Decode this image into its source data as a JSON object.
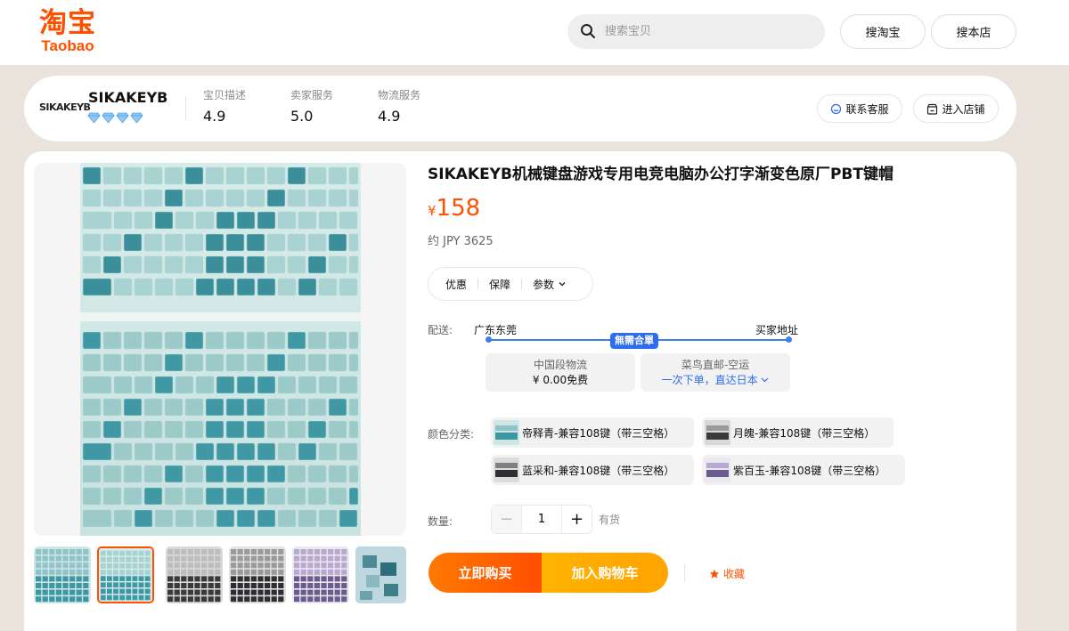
{
  "header": {
    "logo_cn": "淘宝",
    "logo_en": "Taobao",
    "search_placeholder": "搜索宝贝",
    "search_taobao_label": "搜淘宝",
    "search_shop_label": "搜本店"
  },
  "shop": {
    "logo_text": "SIKAKEYB",
    "name": "SIKAKEYB",
    "diamond_count": 4,
    "metrics": [
      {
        "label": "宝贝描述",
        "value": "4.9"
      },
      {
        "label": "卖家服务",
        "value": "5.0"
      },
      {
        "label": "物流服务",
        "value": "4.9"
      }
    ],
    "contact_label": "联系客服",
    "enter_shop_label": "进入店铺"
  },
  "product": {
    "title": "SIKAKEYB机械键盘游戏专用电竞电脑办公打字渐变色原厂PBT键帽",
    "currency_symbol": "¥",
    "price": "158",
    "approx_price": "约 JPY 3625",
    "tabs": [
      "优惠",
      "保障",
      "参数"
    ],
    "shipping": {
      "label": "配送:",
      "from": "广东东莞",
      "to": "买家地址",
      "badge": "無需合單",
      "options": [
        {
          "line1": "中国段物流",
          "line2": "¥ 0.00免费"
        },
        {
          "line1": "菜鸟直邮-空运",
          "line2": "一次下单，直达日本"
        }
      ]
    },
    "color_label": "颜色分类:",
    "variants": [
      "帝释青-兼容108键（带三空格）",
      "月魄-兼容108键（带三空格）",
      "蓝采和-兼容108键（带三空格）",
      "紫百玉-兼容108键（带三空格）"
    ],
    "quantity_label": "数量:",
    "quantity": "1",
    "stock": "有货",
    "buy_now_label": "立即购买",
    "add_cart_label": "加入购物车",
    "favorite_label": "收藏",
    "thumbnail_count": 6,
    "selected_thumbnail": 2,
    "colors": {
      "accent": "#ff5000",
      "blue": "#2f6df0",
      "buy_start": "#ff7a00",
      "cart": "#ffb300"
    }
  }
}
